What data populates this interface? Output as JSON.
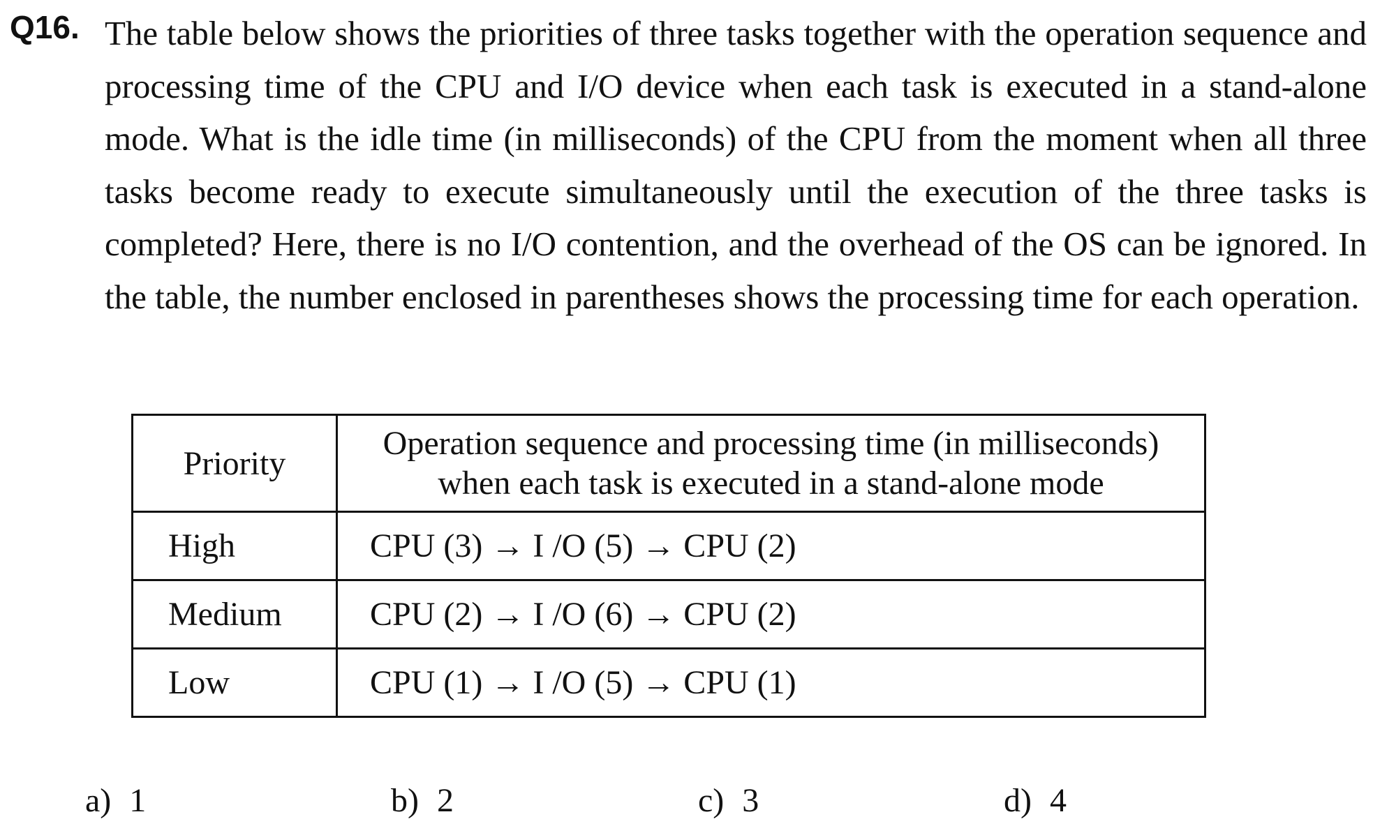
{
  "question": {
    "number": "Q16.",
    "text": "The table below shows the priorities of three tasks together with the operation sequence and processing time of the CPU and I/O device when each task is executed in a stand-alone mode.  What is the idle time (in milliseconds) of the CPU from the moment when all three tasks become ready to execute simultaneously until the execution of the three tasks is completed?  Here, there is no I/O contention, and the overhead of the OS can be ignored.  In the table, the number enclosed in parentheses shows the processing time for each operation."
  },
  "table": {
    "header_priority": "Priority",
    "header_sequence_line1": "Operation sequence and processing time (in milliseconds)",
    "header_sequence_line2": "when each task is executed in a stand-alone mode",
    "rows": [
      {
        "priority": "High",
        "sequence": "CPU (3) → I /O (5) → CPU (2)"
      },
      {
        "priority": "Medium",
        "sequence": "CPU (2) → I /O (6) → CPU (2)"
      },
      {
        "priority": "Low",
        "sequence": "CPU (1) → I /O (5) → CPU (1)"
      }
    ]
  },
  "choices": [
    {
      "label": "a)",
      "value": "1"
    },
    {
      "label": "b)",
      "value": "2"
    },
    {
      "label": "c)",
      "value": "3"
    },
    {
      "label": "d)",
      "value": "4"
    }
  ]
}
